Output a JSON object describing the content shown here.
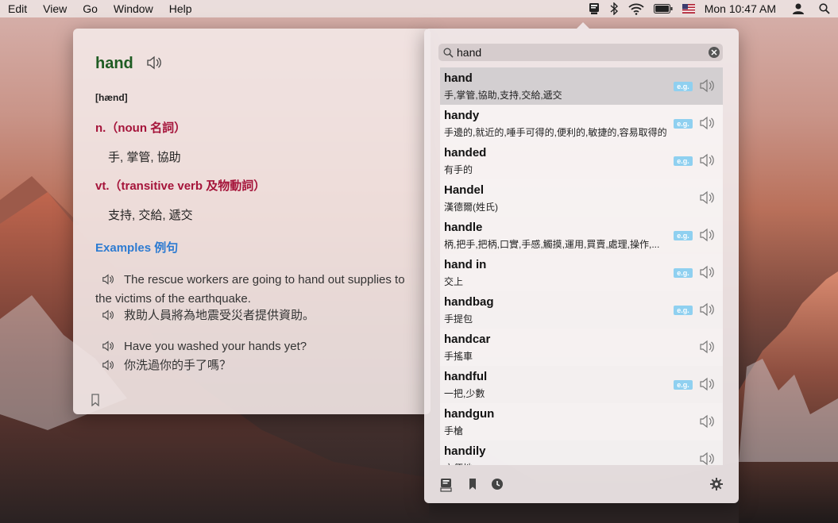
{
  "menubar": {
    "menus": [
      "Edit",
      "View",
      "Go",
      "Window",
      "Help"
    ],
    "clock": "Mon 10:47 AM",
    "icons": [
      "dictionary-icon",
      "bluetooth-icon",
      "wifi-icon",
      "battery-icon",
      "us-flag-icon",
      "user-icon",
      "spotlight-search-icon"
    ]
  },
  "definition": {
    "headword": "hand",
    "phonetic": "[hænd]",
    "senses": [
      {
        "pos": "n.（noun 名詞）",
        "meaning": "手, 掌管, 協助"
      },
      {
        "pos": "vt.（transitive verb 及物動詞）",
        "meaning": "支持, 交給, 遞交"
      }
    ],
    "examples_title": "Examples 例句",
    "examples": [
      {
        "en": "The rescue workers are going to hand out supplies to the victims of the earthquake.",
        "zh": "救助人員將為地震受災者提供資助。"
      },
      {
        "en": "Have you washed your hands yet?",
        "zh": "你洗過你的手了嗎？"
      }
    ]
  },
  "search": {
    "value": "hand",
    "placeholder": "Search"
  },
  "results": [
    {
      "word": "hand",
      "translation": "手,掌管,協助,支持,交給,遞交",
      "has_example": true
    },
    {
      "word": "handy",
      "translation": "手邊的,就近的,唾手可得的,便利的,敏捷的,容易取得的",
      "has_example": true
    },
    {
      "word": "handed",
      "translation": "有手的",
      "has_example": true
    },
    {
      "word": "Handel",
      "translation": "漢德爾(姓氏)",
      "has_example": false
    },
    {
      "word": "handle",
      "translation": "柄,把手,把柄,口實,手感,觸摸,運用,買賣,處理,操作,...",
      "has_example": true
    },
    {
      "word": "hand in",
      "translation": "交上",
      "has_example": true
    },
    {
      "word": "handbag",
      "translation": "手提包",
      "has_example": true
    },
    {
      "word": "handcar",
      "translation": "手搖車",
      "has_example": false
    },
    {
      "word": "handful",
      "translation": "一把,少數",
      "has_example": true
    },
    {
      "word": "handgun",
      "translation": "手槍",
      "has_example": false
    },
    {
      "word": "handily",
      "translation": "方便地",
      "has_example": false
    }
  ],
  "example_badge": "e.g.",
  "bottom_bar": {
    "icons": [
      "dictionary-tab-icon",
      "bookmarks-tab-icon",
      "history-tab-icon",
      "settings-gear-icon"
    ]
  },
  "colors": {
    "headword": "#1f5c23",
    "part_of_speech": "#a5143a",
    "examples_title": "#2d7bd1",
    "example_badge": "#8fd0f0"
  }
}
